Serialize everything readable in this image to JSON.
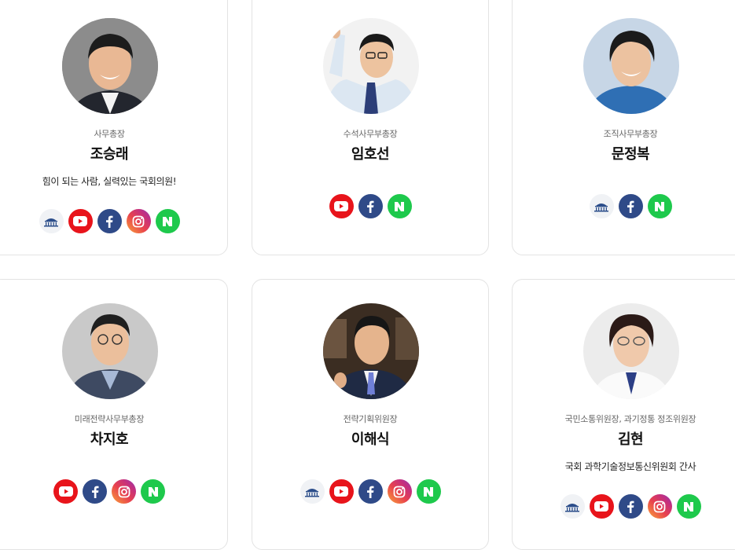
{
  "members": [
    {
      "role": "사무총장",
      "name": "조승래",
      "description": "힘이 되는 사람, 실력있는 국회의원!",
      "socials": [
        "assembly-icon",
        "youtube-icon",
        "facebook-icon",
        "instagram-icon",
        "naver-blog-icon"
      ]
    },
    {
      "role": "수석사무부총장",
      "name": "임호선",
      "description": "",
      "socials": [
        "youtube-icon",
        "facebook-icon",
        "naver-blog-icon"
      ]
    },
    {
      "role": "조직사무부총장",
      "name": "문정복",
      "description": "",
      "socials": [
        "assembly-icon",
        "facebook-icon",
        "naver-blog-icon"
      ]
    },
    {
      "role": "미래전략사무부총장",
      "name": "차지호",
      "description": "",
      "socials": [
        "youtube-icon",
        "facebook-icon",
        "instagram-icon",
        "naver-blog-icon"
      ]
    },
    {
      "role": "전략기획위원장",
      "name": "이해식",
      "description": "",
      "socials": [
        "assembly-icon",
        "youtube-icon",
        "facebook-icon",
        "instagram-icon",
        "naver-blog-icon"
      ]
    },
    {
      "role": "국민소통위원장, 과기정통 정조위원장",
      "name": "김현",
      "description": "국회 과학기술정보통신위원회 간사",
      "socials": [
        "assembly-icon",
        "youtube-icon",
        "facebook-icon",
        "instagram-icon",
        "naver-blog-icon"
      ]
    }
  ],
  "colors": {
    "youtube": "#e8141b",
    "facebook": "#2f4a88",
    "naver": "#1ec94c",
    "assembly": "#f0f2f5",
    "card_border": "#e3e3e3"
  }
}
